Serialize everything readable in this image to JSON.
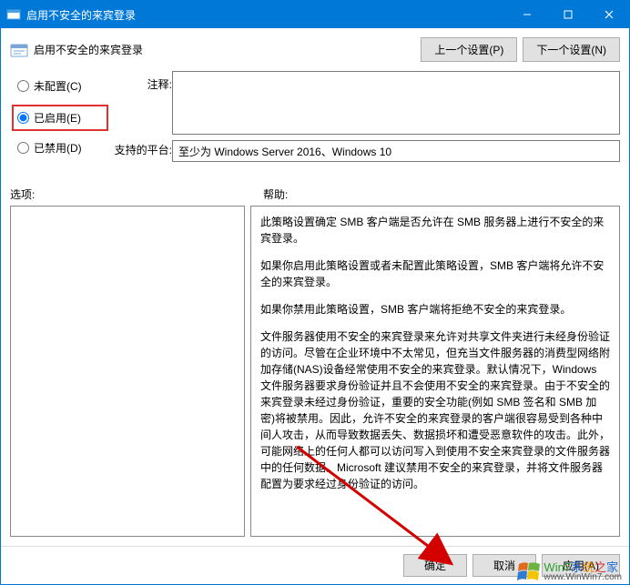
{
  "titlebar": {
    "title": "启用不安全的来宾登录"
  },
  "header": {
    "policy_title": "启用不安全的来宾登录"
  },
  "top_buttons": {
    "prev": "上一个设置(P)",
    "next": "下一个设置(N)"
  },
  "radios": {
    "not_configured": "未配置(C)",
    "enabled": "已启用(E)",
    "disabled": "已禁用(D)"
  },
  "labels": {
    "comment": "注释:",
    "platform": "支持的平台:",
    "options": "选项:",
    "help": "帮助:"
  },
  "fields": {
    "comment_value": "",
    "platform_value": "至少为 Windows Server 2016、Windows 10"
  },
  "help": {
    "p1": "此策略设置确定 SMB 客户端是否允许在 SMB 服务器上进行不安全的来宾登录。",
    "p2": "如果你启用此策略设置或者未配置此策略设置，SMB 客户端将允许不安全的来宾登录。",
    "p3": "如果你禁用此策略设置，SMB 客户端将拒绝不安全的来宾登录。",
    "p4": "文件服务器使用不安全的来宾登录来允许对共享文件夹进行未经身份验证的访问。尽管在企业环境中不太常见，但充当文件服务器的消费型网络附加存储(NAS)设备经常使用不安全的来宾登录。默认情况下，Windows 文件服务器要求身份验证并且不会使用不安全的来宾登录。由于不安全的来宾登录未经过身份验证，重要的安全功能(例如 SMB 签名和 SMB 加密)将被禁用。因此，允许不安全的来宾登录的客户端很容易受到各种中间人攻击，从而导致数据丢失、数据损坏和遭受恶意软件的攻击。此外，可能网络上的任何人都可以访问写入到使用不安全来宾登录的文件服务器中的任何数据。Microsoft 建议禁用不安全的来宾登录，并将文件服务器配置为要求经过身份验证的访问。"
  },
  "footer": {
    "ok": "确定",
    "cancel": "取消",
    "apply": "应用(A)"
  },
  "watermark": {
    "line1_chars": [
      "Win7",
      "系",
      "统",
      "之",
      "家"
    ],
    "line2": "www.WinWin7.com"
  }
}
